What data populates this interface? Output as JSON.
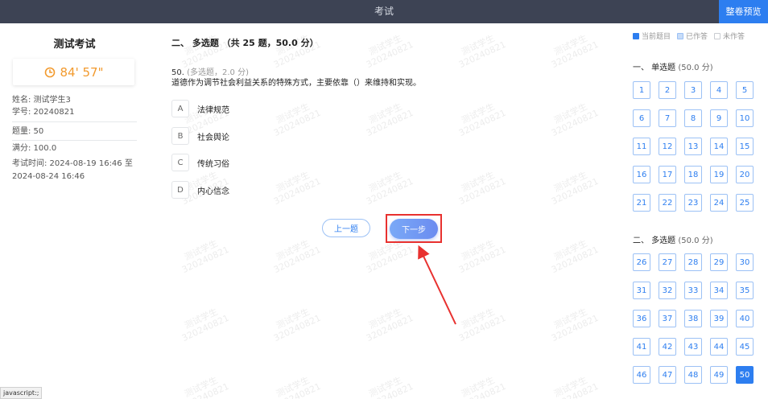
{
  "header": {
    "title": "考试",
    "preview_label": "整卷预览"
  },
  "sidebar": {
    "exam_title": "测试考试",
    "timer": "84' 57\"",
    "name": "姓名: 测试学生3",
    "student_id": "学号: 20240821",
    "question_count": "题量: 50",
    "full_score": "满分: 100.0",
    "exam_time_line1": "考试时间: 2024-08-19 16:46 至",
    "exam_time_line2": "2024-08-24 16:46"
  },
  "main": {
    "section_title": "二、 多选题 （共 25 题，50.0 分）",
    "question_number": "50.",
    "question_meta": "(多选题，2.0 分)",
    "question_text": "道德作为调节社会利益关系的特殊方式，主要依靠（）来维持和实现。",
    "options": [
      {
        "letter": "A",
        "text": "法律规范"
      },
      {
        "letter": "B",
        "text": "社会舆论"
      },
      {
        "letter": "C",
        "text": "传统习俗"
      },
      {
        "letter": "D",
        "text": "内心信念"
      }
    ],
    "prev_label": "上一题",
    "next_label": "下一步",
    "watermark_name": "测试学生",
    "watermark_id": "320240821"
  },
  "answer_sheet": {
    "legend": {
      "current": "当前题目",
      "answered": "已作答",
      "unanswered": "未作答"
    },
    "legend_colors": {
      "current": "#2d7ef0",
      "answered": "#c7dcf8",
      "unanswered": "#ffffff"
    },
    "single_title": "一、 单选题",
    "single_score": "(50.0 分)",
    "multi_title": "二、 多选题",
    "multi_score": "(50.0 分)",
    "single_questions": [
      "1",
      "2",
      "3",
      "4",
      "5",
      "6",
      "7",
      "8",
      "9",
      "10",
      "11",
      "12",
      "13",
      "14",
      "15",
      "16",
      "17",
      "18",
      "19",
      "20",
      "21",
      "22",
      "23",
      "24",
      "25"
    ],
    "multi_questions": [
      "26",
      "27",
      "28",
      "29",
      "30",
      "31",
      "32",
      "33",
      "34",
      "35",
      "36",
      "37",
      "38",
      "39",
      "40",
      "41",
      "42",
      "43",
      "44",
      "45",
      "46",
      "47",
      "48",
      "49",
      "50"
    ],
    "current_question": "50"
  },
  "status_bar": {
    "url": "javascript:;"
  }
}
